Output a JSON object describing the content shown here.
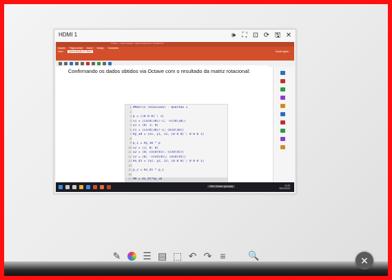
{
  "hdmi_window": {
    "title": "HDMI 1",
    "controls": {
      "speaker": "🕪",
      "fit": "⛶",
      "capture": "⊡",
      "refresh": "⟳",
      "save": "🖫",
      "close": "✕"
    }
  },
  "powerpoint": {
    "window_title": "Octave — Apresentação - Matriz Rotacional - PowerPoint",
    "menu": [
      "Arquivo",
      "Página Inicial",
      "Inserir",
      "Design",
      "Transições"
    ],
    "tabs": [
      "Início",
      "Apresentação de Slides"
    ],
    "user_name": "Daniel Aguiar",
    "slide_caption": "Confirmando os dados obtidos via Octave com o resultado da matriz rotacional:"
  },
  "octave_code": [
    {
      "n": "1",
      "text": "#Matriz rotacional - Questão 1"
    },
    {
      "n": "2",
      "text": ""
    },
    {
      "n": "3",
      "text": "p = [[0 0 0]'; 1]"
    },
    {
      "n": "4",
      "text": "x1 = [cosd(30)/-1; -sind(30)]"
    },
    {
      "n": "5",
      "text": "y1 = [0; 1; 0]"
    },
    {
      "n": "6",
      "text": "z1 = [sind(30)/-1; cosd(30)]"
    },
    {
      "n": "7",
      "text": "Ry_30 = [x1, y1, z1, [0 0 0]'; 0 0 0 1]"
    },
    {
      "n": "8",
      "text": ""
    },
    {
      "n": "9",
      "text": "p_1 = Ry_30 * p"
    },
    {
      "n": "10",
      "text": "x2 = [1; 0; 0]"
    },
    {
      "n": "11",
      "text": "y2 = [0; cosd(45); sind(45)]"
    },
    {
      "n": "12",
      "text": "z2 = [0; -sind(45); cosd(45)]"
    },
    {
      "n": "13",
      "text": "Rx_45 = [x2, y2, z2, [0 0 0]'; 0 0 0 1]"
    },
    {
      "n": "14",
      "text": ""
    },
    {
      "n": "15",
      "text": "p_2 = Rx_45 * p_1"
    },
    {
      "n": "16",
      "text": ""
    },
    {
      "n": "17",
      "text": "MR = Rx_45*Ry_30"
    }
  ],
  "taskbar": {
    "active_app": "GNU Octave (prompt)",
    "time": "10:25",
    "date": "28/11/2023"
  },
  "board_tools": {
    "pen": "✎",
    "stack": "☰",
    "page": "▤",
    "select": "⬚",
    "undo": "↶",
    "redo": "↷",
    "menu": "≡",
    "search": "🔍",
    "close": "✕"
  },
  "colors": {
    "frame": "#ff1010",
    "ppt_accent": "#d34f2b",
    "code_text": "#2a2a9a"
  }
}
